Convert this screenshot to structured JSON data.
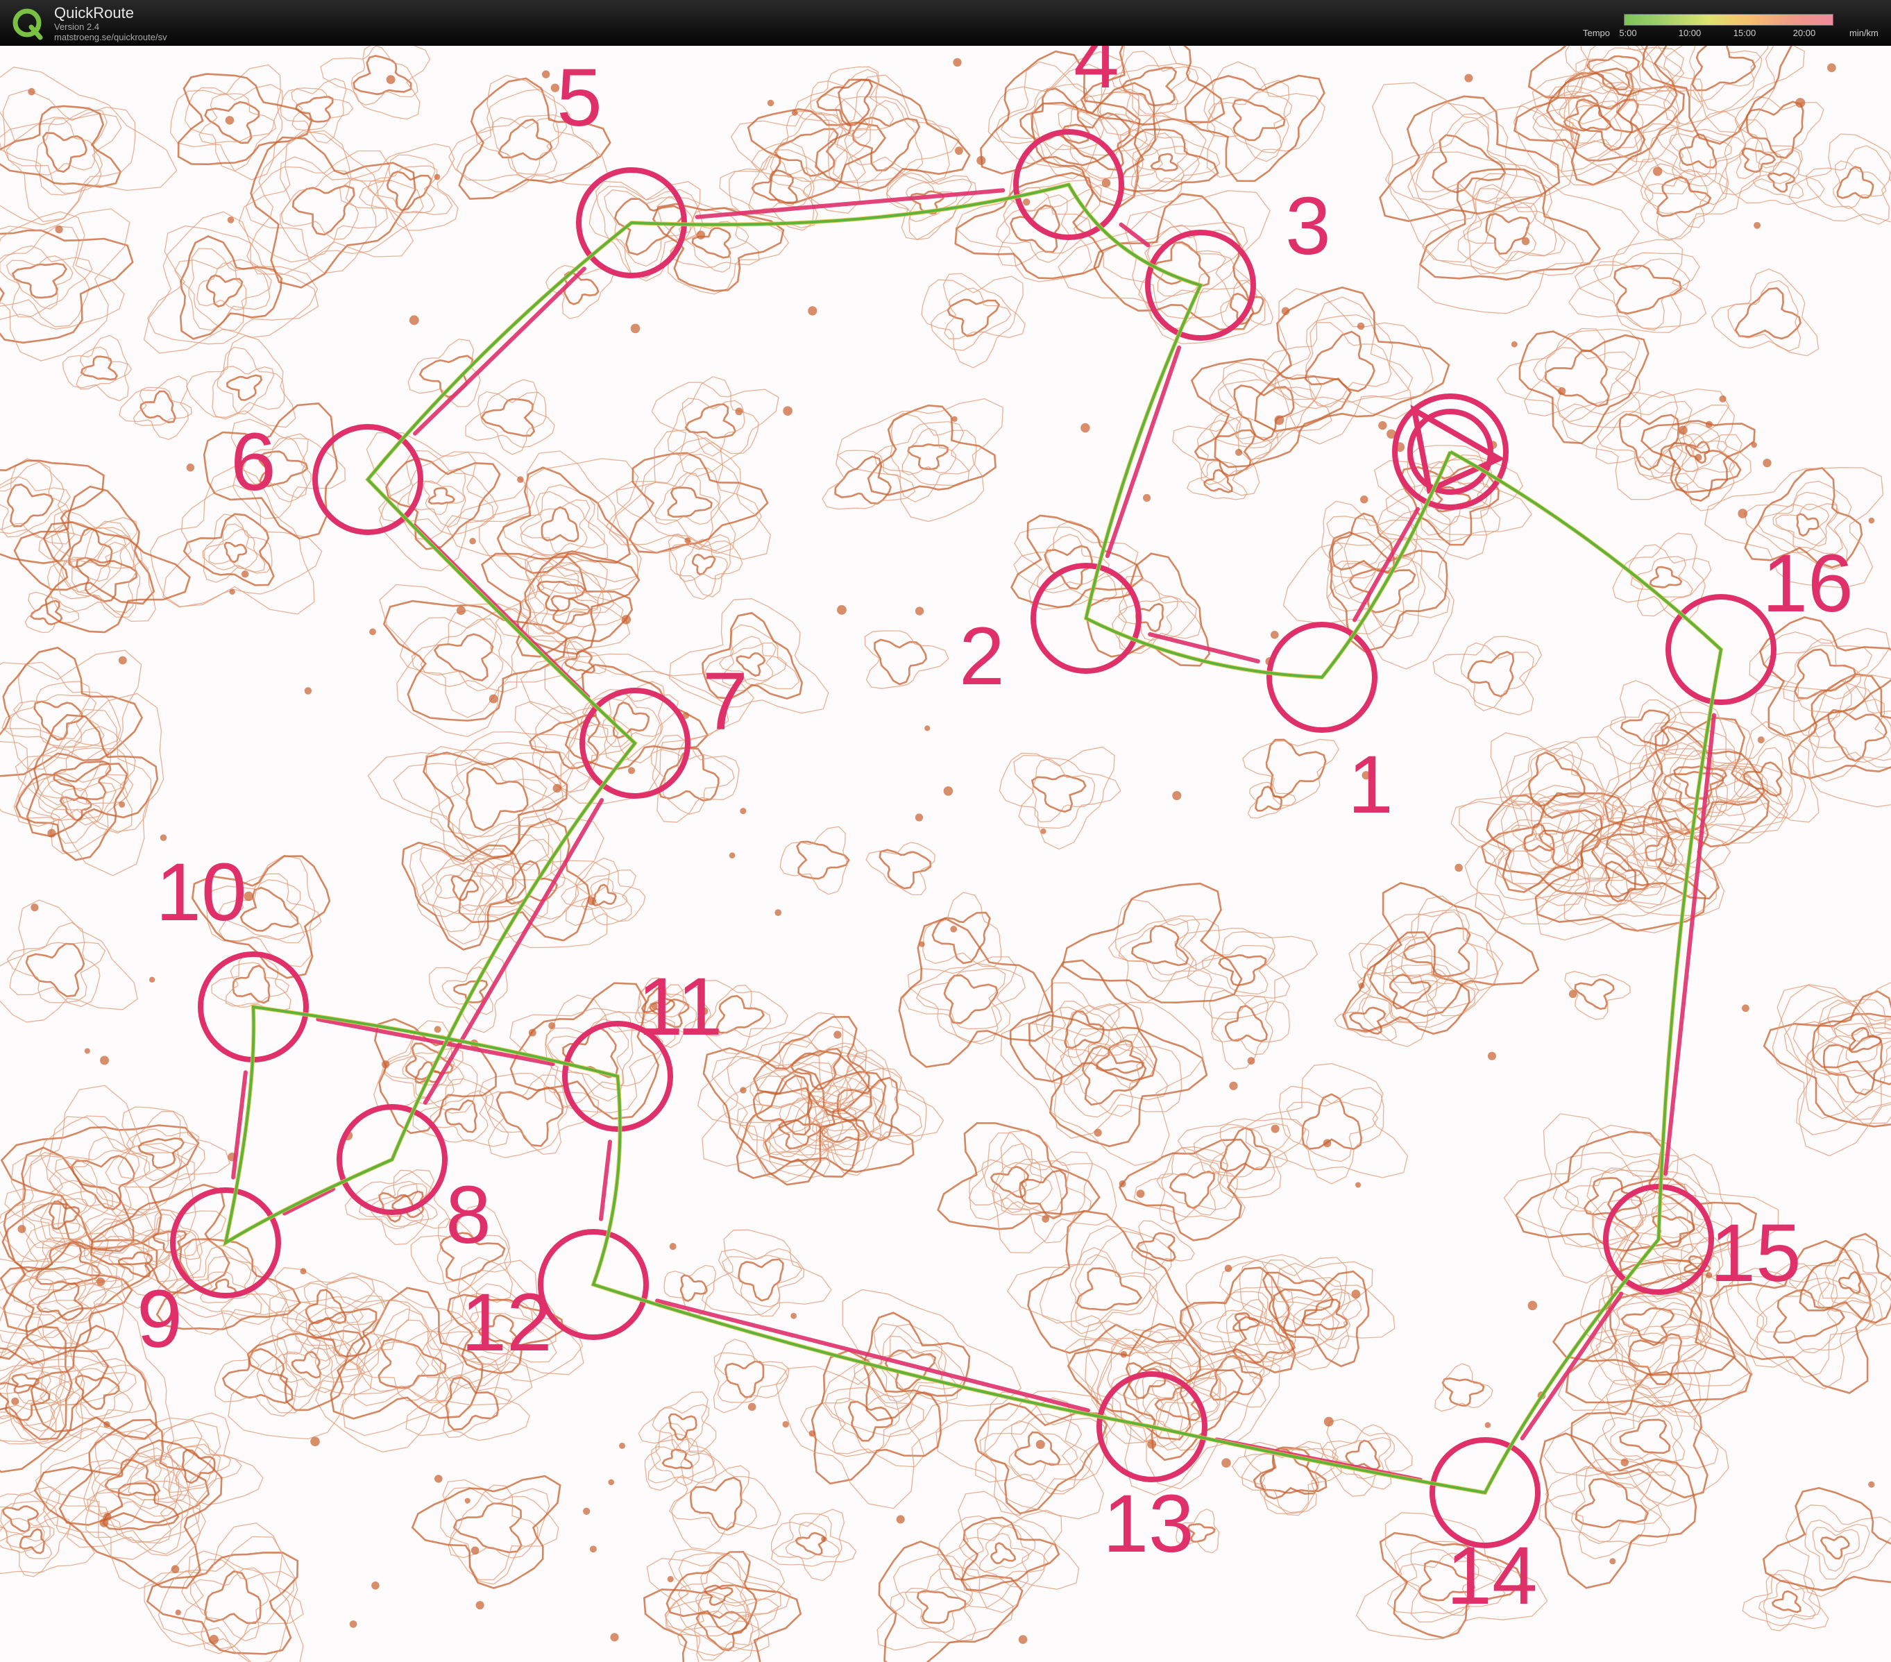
{
  "app": {
    "name": "QuickRoute",
    "version": "Version 2.4",
    "url": "matstroeng.se/quickroute/sv"
  },
  "legend": {
    "title": "Tempo",
    "ticks": [
      "5:00",
      "10:00",
      "15:00",
      "20:00"
    ],
    "unit": "min/km",
    "gradient": [
      "#7cc35a",
      "#a7d26a",
      "#dde36f",
      "#f6c06e",
      "#f19a88",
      "#ef8a9c"
    ]
  },
  "colors": {
    "course": "#e0306a",
    "contour": "#c8602e",
    "contour_light": "#e39a76",
    "route": "#5eb33b",
    "route_slow": "#e7c34a",
    "paper": "#fdfbfb"
  },
  "controls": [
    {
      "label": "1"
    },
    {
      "label": "2"
    },
    {
      "label": "3"
    },
    {
      "label": "4"
    },
    {
      "label": "5"
    },
    {
      "label": "6"
    },
    {
      "label": "7"
    },
    {
      "label": "8"
    },
    {
      "label": "9"
    },
    {
      "label": "10"
    },
    {
      "label": "11"
    },
    {
      "label": "12"
    },
    {
      "label": "13"
    },
    {
      "label": "14"
    },
    {
      "label": "15"
    },
    {
      "label": "16"
    }
  ]
}
